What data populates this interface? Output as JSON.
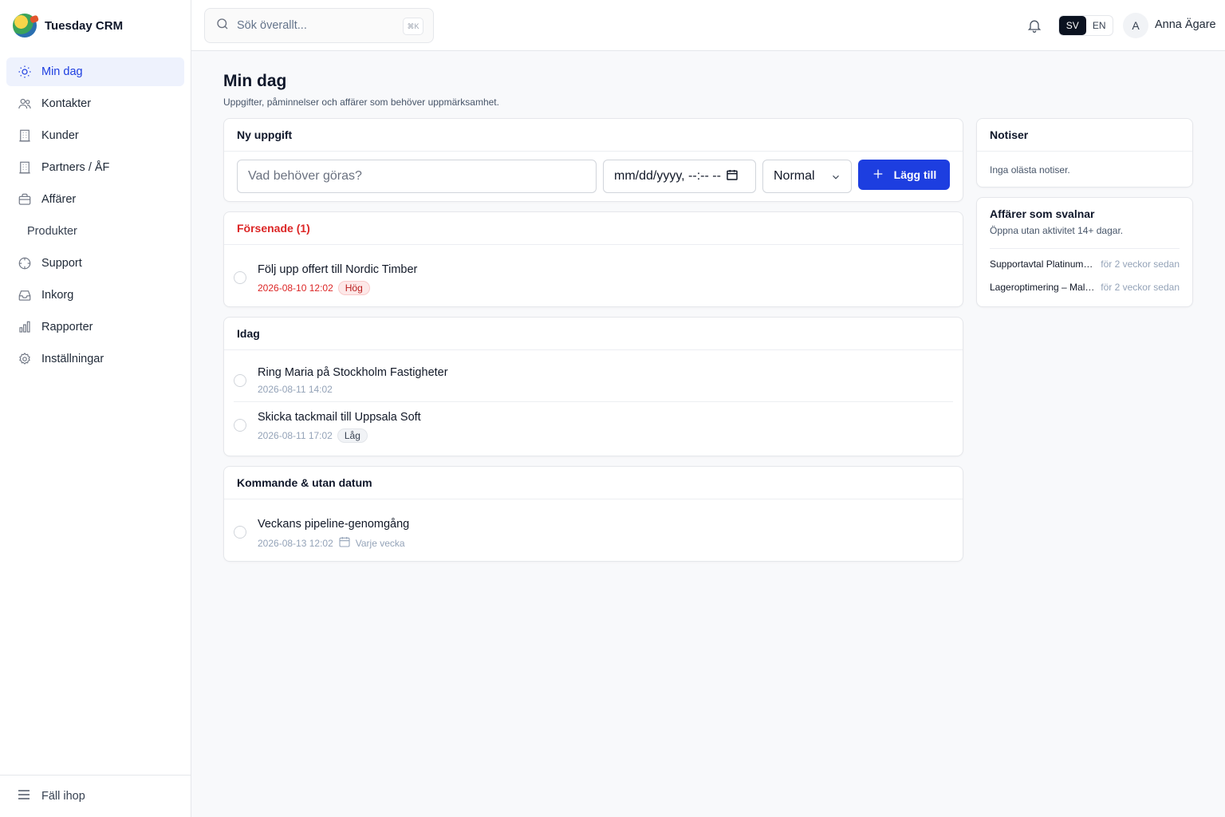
{
  "app": {
    "name": "Tuesday CRM"
  },
  "sidebar": {
    "items": [
      {
        "label": "Min dag",
        "icon": "sun-icon"
      },
      {
        "label": "Kontakter",
        "icon": "users-icon"
      },
      {
        "label": "Kunder",
        "icon": "building-icon"
      },
      {
        "label": "Partners / ÅF",
        "icon": "building-icon"
      },
      {
        "label": "Affärer",
        "icon": "briefcase-icon"
      },
      {
        "label": "Produkter"
      },
      {
        "label": "Support",
        "icon": "lifebuoy-icon"
      },
      {
        "label": "Inkorg",
        "icon": "inbox-icon"
      },
      {
        "label": "Rapporter",
        "icon": "chart-icon"
      },
      {
        "label": "Inställningar",
        "icon": "gear-icon"
      }
    ],
    "collapse_label": "Fäll ihop"
  },
  "topbar": {
    "search_placeholder": "Sök överallt...",
    "shortcut": "⌘K",
    "lang": [
      "SV",
      "EN"
    ],
    "avatar_initial": "A",
    "user_name": "Anna Ägare"
  },
  "page": {
    "title": "Min dag",
    "subtitle": "Uppgifter, påminnelser och affärer som behöver uppmärksamhet."
  },
  "new_task": {
    "heading": "Ny uppgift",
    "placeholder": "Vad behöver göras?",
    "date_placeholder": "mm/dd/yyyy, --:-- --",
    "priority": "Normal",
    "add_label": "Lägg till"
  },
  "overdue": {
    "heading": "Försenade (1)",
    "tasks": [
      {
        "title": "Följ upp offert till Nordic Timber",
        "datetime": "2026-08-10 12:02",
        "badge": "Hög"
      }
    ]
  },
  "today": {
    "heading": "Idag",
    "tasks": [
      {
        "title": "Ring Maria på Stockholm Fastigheter",
        "datetime": "2026-08-11 14:02"
      },
      {
        "title": "Skicka tackmail till Uppsala Soft",
        "datetime": "2026-08-11 17:02",
        "badge": "Låg"
      }
    ]
  },
  "upcoming": {
    "heading": "Kommande & utan datum",
    "tasks": [
      {
        "title": "Veckans pipeline-genomgång",
        "datetime": "2026-08-13 12:02",
        "recurrence": "Varje vecka"
      }
    ]
  },
  "notifications": {
    "heading": "Notiser",
    "empty": "Inga olästa notiser."
  },
  "cooling_deals": {
    "heading": "Affärer som svalnar",
    "subtitle": "Öppna utan aktivitet 14+ dagar.",
    "deals": [
      {
        "name": "Supportavtal Platinum – Nordic Timber",
        "ago": "för 2 veckor sedan"
      },
      {
        "name": "Lageroptimering – Malmö Logistik",
        "ago": "för 2 veckor sedan"
      }
    ]
  },
  "colors": {
    "accent": "#1d3ee0",
    "danger": "#dc2626",
    "active_bg": "#eef2fd"
  }
}
